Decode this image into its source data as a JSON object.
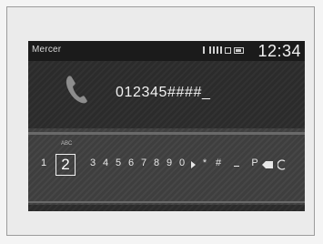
{
  "status_bar": {
    "device_name": "Mercer",
    "clock": "12:34"
  },
  "dialer": {
    "number": "012345####_"
  },
  "keypad": {
    "hint": "ABC",
    "selected_key": "2",
    "keys": [
      "1",
      "3",
      "4",
      "5",
      "6",
      "7",
      "8",
      "9",
      "0",
      "*",
      "#",
      "P"
    ]
  },
  "icons": {
    "status": [
      "bluetooth-icon",
      "signal-icon",
      "roaming-icon",
      "battery-icon"
    ],
    "dialer": "phone-handset-icon",
    "keypad_extra": [
      "next-icon",
      "dash-icon",
      "backspace-icon",
      "clear-icon"
    ]
  },
  "colors": {
    "screen_bg": "#2b2b2b",
    "status_bg": "#1b1b1b",
    "panel_bg": "#3e3e3e",
    "text": "#f2f2f2"
  }
}
